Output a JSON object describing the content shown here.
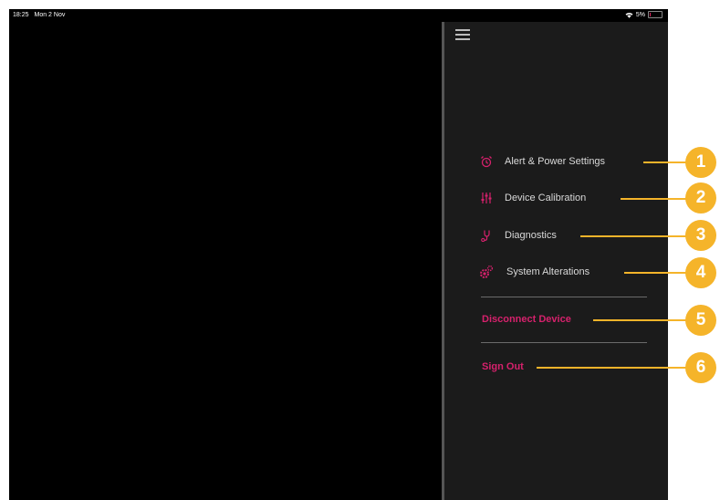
{
  "status_bar": {
    "time": "18:25",
    "date": "Mon 2 Nov",
    "battery": "5%",
    "wifi_icon": "wifi-icon"
  },
  "menu": {
    "items": [
      {
        "label": "Alert & Power Settings",
        "icon": "alarm-clock-icon"
      },
      {
        "label": "Device Calibration",
        "icon": "sliders-icon"
      },
      {
        "label": "Diagnostics",
        "icon": "stethoscope-icon"
      },
      {
        "label": "System Alterations",
        "icon": "gear-icon"
      }
    ],
    "disconnect_label": "Disconnect Device",
    "signout_label": "Sign Out"
  },
  "callouts": [
    "1",
    "2",
    "3",
    "4",
    "5",
    "6"
  ],
  "colors": {
    "accent": "#d6216c",
    "callout": "#f5b42a",
    "panel": "#1b1b1b"
  }
}
